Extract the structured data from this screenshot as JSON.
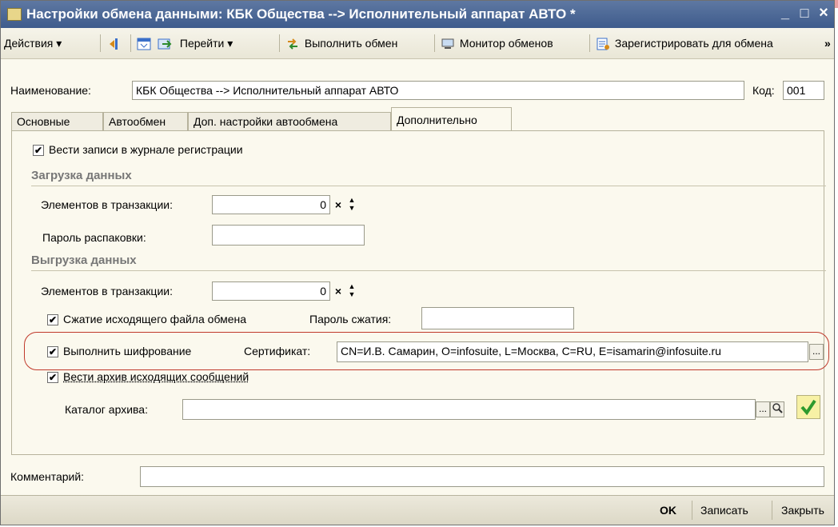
{
  "window": {
    "title": "Настройки обмена данными: КБК Общества --> Исполнительный аппарат АВТО *",
    "minimize": "_",
    "maximize": "□",
    "close": "×"
  },
  "toolbar": {
    "actions": "Действия ▾",
    "goto": "Перейти ▾",
    "run_exchange": "Выполнить обмен",
    "monitor": "Монитор обменов",
    "register": "Зарегистрировать для обмена",
    "overflow": "»"
  },
  "header": {
    "name_label": "Наименование:",
    "name_value": "КБК Общества --> Исполнительный аппарат АВТО",
    "code_label": "Код:",
    "code_value": "001"
  },
  "tabs": [
    {
      "label": "Основные"
    },
    {
      "label": "Автообмен"
    },
    {
      "label": "Доп. настройки автообмена"
    },
    {
      "label": "Дополнительно"
    }
  ],
  "panel": {
    "log_label": "Вести записи в журнале регистрации",
    "load_group": "Загрузка данных",
    "load_elements_label": "Элементов в транзакции:",
    "load_elements_value": "0",
    "unpack_password_label": "Пароль распаковки:",
    "upload_group": "Выгрузка данных",
    "upload_elements_label": "Элементов в транзакции:",
    "upload_elements_value": "0",
    "compress_label": "Сжатие исходящего файла обмена",
    "compress_password_label": "Пароль сжатия:",
    "encrypt_label": "Выполнить шифрование",
    "cert_label": "Сертификат:",
    "cert_value": "CN=И.В. Самарин, O=infosuite, L=Москва, C=RU, E=isamarin@infosuite.ru",
    "archive_label": "Вести архив исходящих сообщений",
    "archive_dir_label": "Каталог архива:",
    "ellipsis": "...",
    "clear_symbol": "×"
  },
  "comment": {
    "label": "Комментарий:"
  },
  "footer": {
    "ok": "OK",
    "save": "Записать",
    "close": "Закрыть"
  },
  "colors": {
    "titlebar": "#4b6796",
    "highlight": "#c0392b",
    "background": "#fbf9ee"
  }
}
